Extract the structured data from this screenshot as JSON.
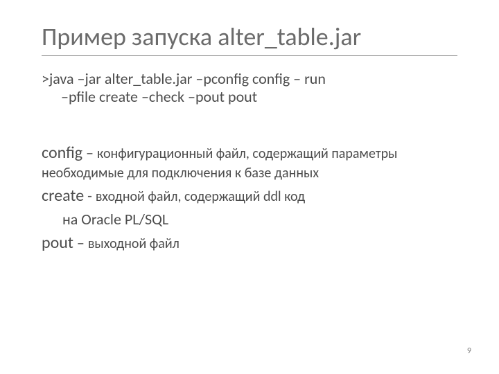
{
  "title": "Пример запуска alter_table.jar",
  "command": {
    "line1": ">java –jar alter_table.jar –pconfig config – run",
    "line2": "–pfile create –check –pout pout"
  },
  "descriptions": {
    "config_term": "config",
    "config_sep": " – ",
    "config_text": "конфигурационный файл, содержащий параметры необходимые для подключения к базе данных",
    "create_term": "create",
    "create_sep": "  - ",
    "create_text": "входной файл, содержащий ddl код",
    "create_text2": "на Oracle PL/SQL",
    "pout_term": "pout",
    "pout_sep": " – ",
    "pout_text": "выходной файл"
  },
  "page_number": "9"
}
